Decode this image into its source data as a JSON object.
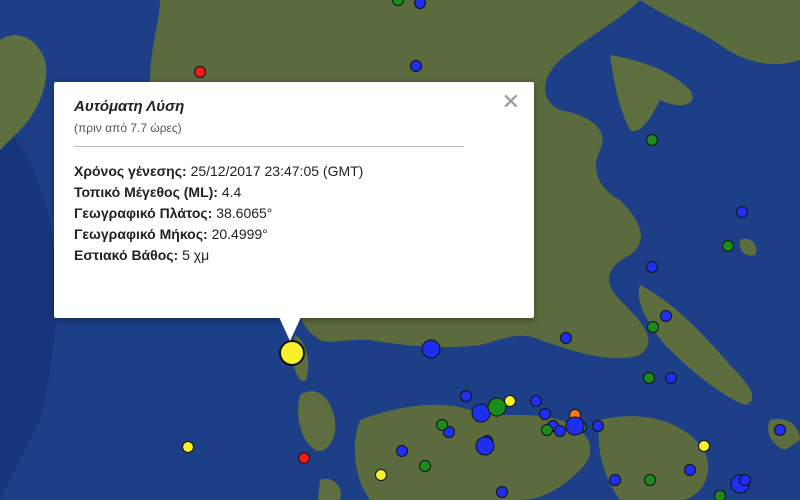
{
  "popup": {
    "title": "Αυτόματη Λύση",
    "subtitle": "(πριν από 7.7 ώρες)",
    "close_icon": "close-icon",
    "fields": [
      {
        "label": "Χρόνος γένεσης:",
        "value": "25/12/2017  23:47:05 (GMT)"
      },
      {
        "label": "Τοπικό Μέγεθος (ML):",
        "value": "4.4"
      },
      {
        "label": "Γεωγραφικό Πλάτος:",
        "value": "38.6065°"
      },
      {
        "label": "Γεωγραφικό Μήκος:",
        "value": "20.4999°"
      },
      {
        "label": "Εστιακό Βάθος:",
        "value": "5 χμ"
      }
    ]
  },
  "colors": {
    "sea": "#1c3f87",
    "land": "#5b6b3d",
    "marker_yellow": "#f7f02a",
    "marker_blue": "#1f2ff0",
    "marker_green": "#1a8c1a",
    "marker_red": "#ee1b1b",
    "marker_orange": "#ff7a1a"
  },
  "markers": [
    {
      "color": "yellow",
      "size": "large",
      "selected": true
    },
    {
      "color": "red",
      "size": "small"
    },
    {
      "color": "blue",
      "size": "small"
    },
    {
      "color": "green",
      "size": "small"
    },
    {
      "color": "blue",
      "size": "small"
    },
    {
      "color": "green",
      "size": "small"
    },
    {
      "color": "blue",
      "size": "small"
    },
    {
      "color": "green",
      "size": "small"
    },
    {
      "color": "blue",
      "size": "small"
    },
    {
      "color": "blue",
      "size": "small"
    },
    {
      "color": "green",
      "size": "small"
    },
    {
      "color": "blue",
      "size": "small"
    },
    {
      "color": "blue",
      "size": "medium"
    },
    {
      "color": "green",
      "size": "small"
    },
    {
      "color": "blue",
      "size": "small"
    },
    {
      "color": "blue",
      "size": "small"
    },
    {
      "color": "blue",
      "size": "medium"
    },
    {
      "color": "yellow",
      "size": "small"
    },
    {
      "color": "blue",
      "size": "small"
    },
    {
      "color": "orange",
      "size": "small"
    },
    {
      "color": "green",
      "size": "medium"
    },
    {
      "color": "blue",
      "size": "small"
    },
    {
      "color": "blue",
      "size": "small"
    },
    {
      "color": "green",
      "size": "small"
    },
    {
      "color": "blue",
      "size": "small"
    },
    {
      "color": "blue",
      "size": "small"
    },
    {
      "color": "blue",
      "size": "small"
    },
    {
      "color": "blue",
      "size": "medium"
    },
    {
      "color": "blue",
      "size": "medium"
    },
    {
      "color": "blue",
      "size": "small"
    },
    {
      "color": "blue",
      "size": "small"
    },
    {
      "color": "green",
      "size": "small"
    },
    {
      "color": "green",
      "size": "small"
    },
    {
      "color": "red",
      "size": "small"
    },
    {
      "color": "yellow",
      "size": "small"
    },
    {
      "color": "yellow",
      "size": "small"
    },
    {
      "color": "yellow",
      "size": "small"
    },
    {
      "color": "blue",
      "size": "medium"
    },
    {
      "color": "blue",
      "size": "small"
    },
    {
      "color": "blue",
      "size": "small"
    },
    {
      "color": "green",
      "size": "small"
    },
    {
      "color": "green",
      "size": "small"
    },
    {
      "color": "blue",
      "size": "small"
    },
    {
      "color": "blue",
      "size": "small"
    },
    {
      "color": "green",
      "size": "small"
    },
    {
      "color": "blue",
      "size": "small"
    }
  ]
}
